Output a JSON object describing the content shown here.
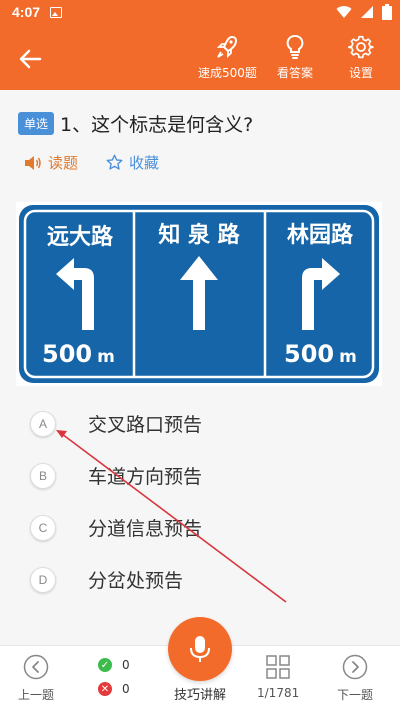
{
  "status_bar": {
    "time": "4:07",
    "icons": [
      "image-icon",
      "wifi-icon",
      "signal-icon",
      "battery-icon"
    ]
  },
  "header": {
    "back_icon": "back-arrow-icon",
    "actions": [
      {
        "label": "速成500题",
        "icon": "rocket-icon"
      },
      {
        "label": "看答案",
        "icon": "bulb-icon"
      },
      {
        "label": "设置",
        "icon": "gear-icon"
      }
    ]
  },
  "question": {
    "type_tag": "单选",
    "text": "1、这个标志是何含义?",
    "read_label": "读题",
    "favorite_label": "收藏"
  },
  "sign": {
    "panels": [
      {
        "name": "远大路",
        "distance": "500",
        "unit": "m",
        "direction": "left"
      },
      {
        "name": "知 泉 路",
        "distance": "",
        "unit": "",
        "direction": "straight"
      },
      {
        "name": "林园路",
        "distance": "500",
        "unit": "m",
        "direction": "right"
      }
    ],
    "colors": {
      "blue": "#1565a8",
      "white": "#ffffff"
    }
  },
  "options": [
    {
      "letter": "A",
      "text": "交叉路口预告"
    },
    {
      "letter": "B",
      "text": "车道方向预告"
    },
    {
      "letter": "C",
      "text": "分道信息预告"
    },
    {
      "letter": "D",
      "text": "分岔处预告"
    }
  ],
  "bottom_bar": {
    "prev_label": "上一题",
    "correct_count": "0",
    "wrong_count": "0",
    "tips_label": "技巧讲解",
    "progress": "1/1781",
    "next_label": "下一题"
  },
  "colors": {
    "accent": "#f26b2a",
    "tag_blue": "#4a90d9",
    "correct": "#3dbb4c",
    "wrong": "#e33b3b",
    "annotation": "#d9363e"
  }
}
